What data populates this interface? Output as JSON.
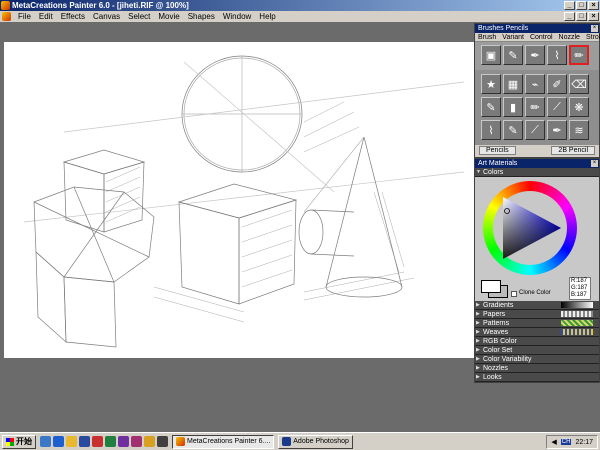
{
  "window": {
    "title": "MetaCreations Painter 6.0 - [jiheti.RIF @ 100%]",
    "controls": [
      "_",
      "□",
      "×"
    ]
  },
  "menu": {
    "items": [
      "File",
      "Edit",
      "Effects",
      "Canvas",
      "Select",
      "Movie",
      "Shapes",
      "Window",
      "Help"
    ],
    "doc_controls": [
      "_",
      "□",
      "×"
    ]
  },
  "brushes": {
    "title": "Brushes Pencils",
    "menu": [
      "Brush",
      "Variant",
      "Control",
      "Nozzle",
      "Stroke"
    ],
    "brush_name": "Pencils",
    "variant_name": "2B Pencil"
  },
  "art_materials": {
    "title": "Art Materials",
    "colors_label": "Colors",
    "clone_color_label": "Clone Color",
    "rgb": {
      "r": "R:187",
      "g": "G:187",
      "b": "B:187"
    },
    "sections": [
      "Gradients",
      "Papers",
      "Patterns",
      "Weaves",
      "RGB Color",
      "Color Set",
      "Color Variability",
      "Nozzles",
      "Looks"
    ]
  },
  "taskbar": {
    "start_label": "开始",
    "tasks": [
      {
        "label": "MetaCreations Painter 6....",
        "active": true
      },
      {
        "label": "Adobe Photoshop",
        "active": false
      }
    ],
    "ime": "CH",
    "clock": "22:17"
  }
}
